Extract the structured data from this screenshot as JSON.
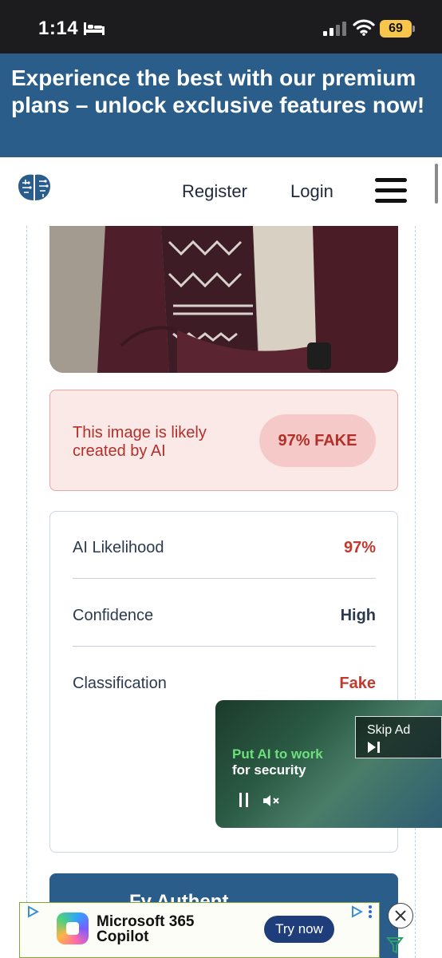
{
  "status_bar": {
    "time": "1:14",
    "battery": "69"
  },
  "promo": {
    "text": "Experience the best with our premium plans – unlock exclusive features now!"
  },
  "nav": {
    "register": "Register",
    "login": "Login"
  },
  "verdict": {
    "message": "This image is likely created by AI",
    "badge": "97% FAKE"
  },
  "details": {
    "rows": [
      {
        "label": "AI Likelihood",
        "value": "97%",
        "value_color": "#c23a2e"
      },
      {
        "label": "Confidence",
        "value": "High",
        "value_color": "#2c3a4f"
      },
      {
        "label": "Classification",
        "value": "Fake",
        "value_color": "#c23a2e"
      }
    ]
  },
  "blue_card": {
    "text": "Fy Authent"
  },
  "video_ad": {
    "headline": "Put AI to work",
    "subline": "for security",
    "skip_label": "Skip Ad"
  },
  "bottom_ad": {
    "title_line1": "Microsoft 365",
    "title_line2": "Copilot",
    "cta": "Try now"
  },
  "colors": {
    "brand_blue": "#2a5d8a",
    "fake_red": "#c23a2e",
    "verdict_bg": "#fbe9e8"
  }
}
